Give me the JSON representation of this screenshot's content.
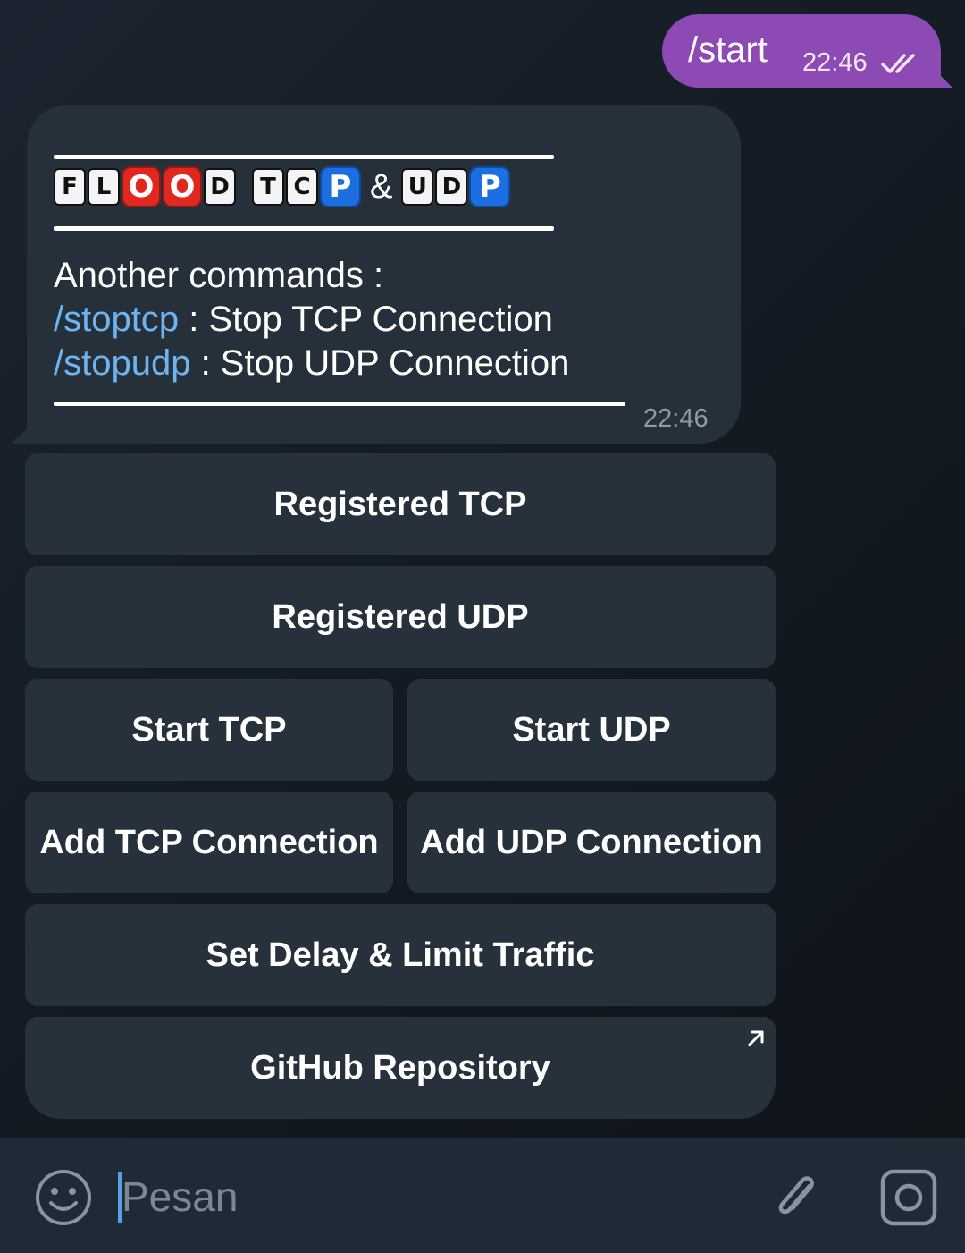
{
  "outgoing": {
    "text": "/start",
    "time": "22:46",
    "status_icon": "double-check-icon"
  },
  "incoming": {
    "title_tiles": {
      "word1": [
        "F",
        "L",
        "O",
        "O",
        "D"
      ],
      "word2": [
        "T",
        "C",
        "P"
      ],
      "amp": "&",
      "word3": [
        "U",
        "D",
        "P"
      ]
    },
    "heading": "Another commands :",
    "commands": [
      {
        "cmd": "/stoptcp",
        "desc": " : Stop TCP Connection"
      },
      {
        "cmd": "/stopudp",
        "desc": " : Stop UDP Connection"
      }
    ],
    "time": "22:46"
  },
  "keyboard": {
    "registered_tcp": "Registered TCP",
    "registered_udp": "Registered UDP",
    "start_tcp": "Start TCP",
    "start_udp": "Start UDP",
    "add_tcp": "Add TCP Connection",
    "add_udp": "Add UDP Connection",
    "set_delay": "Set Delay & Limit Traffic",
    "github": "GitHub Repository"
  },
  "input_bar": {
    "placeholder": "Pesan",
    "value": ""
  },
  "colors": {
    "outgoing_bubble": "#8d49b4",
    "incoming_bubble": "#26303b",
    "link": "#6fb4ee",
    "red_tile": "#e0281e",
    "blue_tile": "#1c6fe0"
  }
}
